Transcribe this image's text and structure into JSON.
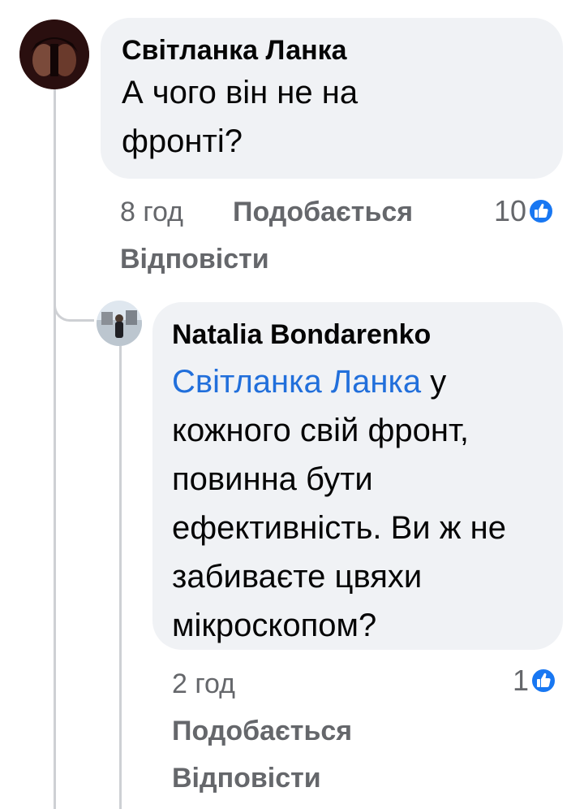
{
  "comment": {
    "author": "Світланка Ланка",
    "text": "А чого він не на фронті?",
    "time": "8 год",
    "like_label": "Подобається",
    "reply_label": "Відповісти",
    "reaction_count": "10",
    "reaction_icon": "like-icon"
  },
  "reply": {
    "author": "Natalia Bondarenko",
    "mention": "Світланка Ланка",
    "text": " у кожного свій фронт, повинна бути ефективність. Ви ж не забиваєте цвяхи мікроскопом?",
    "time": "2 год",
    "like_label": "Подобається",
    "reply_label": "Відповісти",
    "reaction_count": "1",
    "reaction_icon": "like-icon"
  },
  "colors": {
    "bubble": "#f0f2f5",
    "mention": "#216fdb",
    "meta_text": "#65676b",
    "like_blue": "#1877f2",
    "thread_line": "#ced0d4"
  }
}
